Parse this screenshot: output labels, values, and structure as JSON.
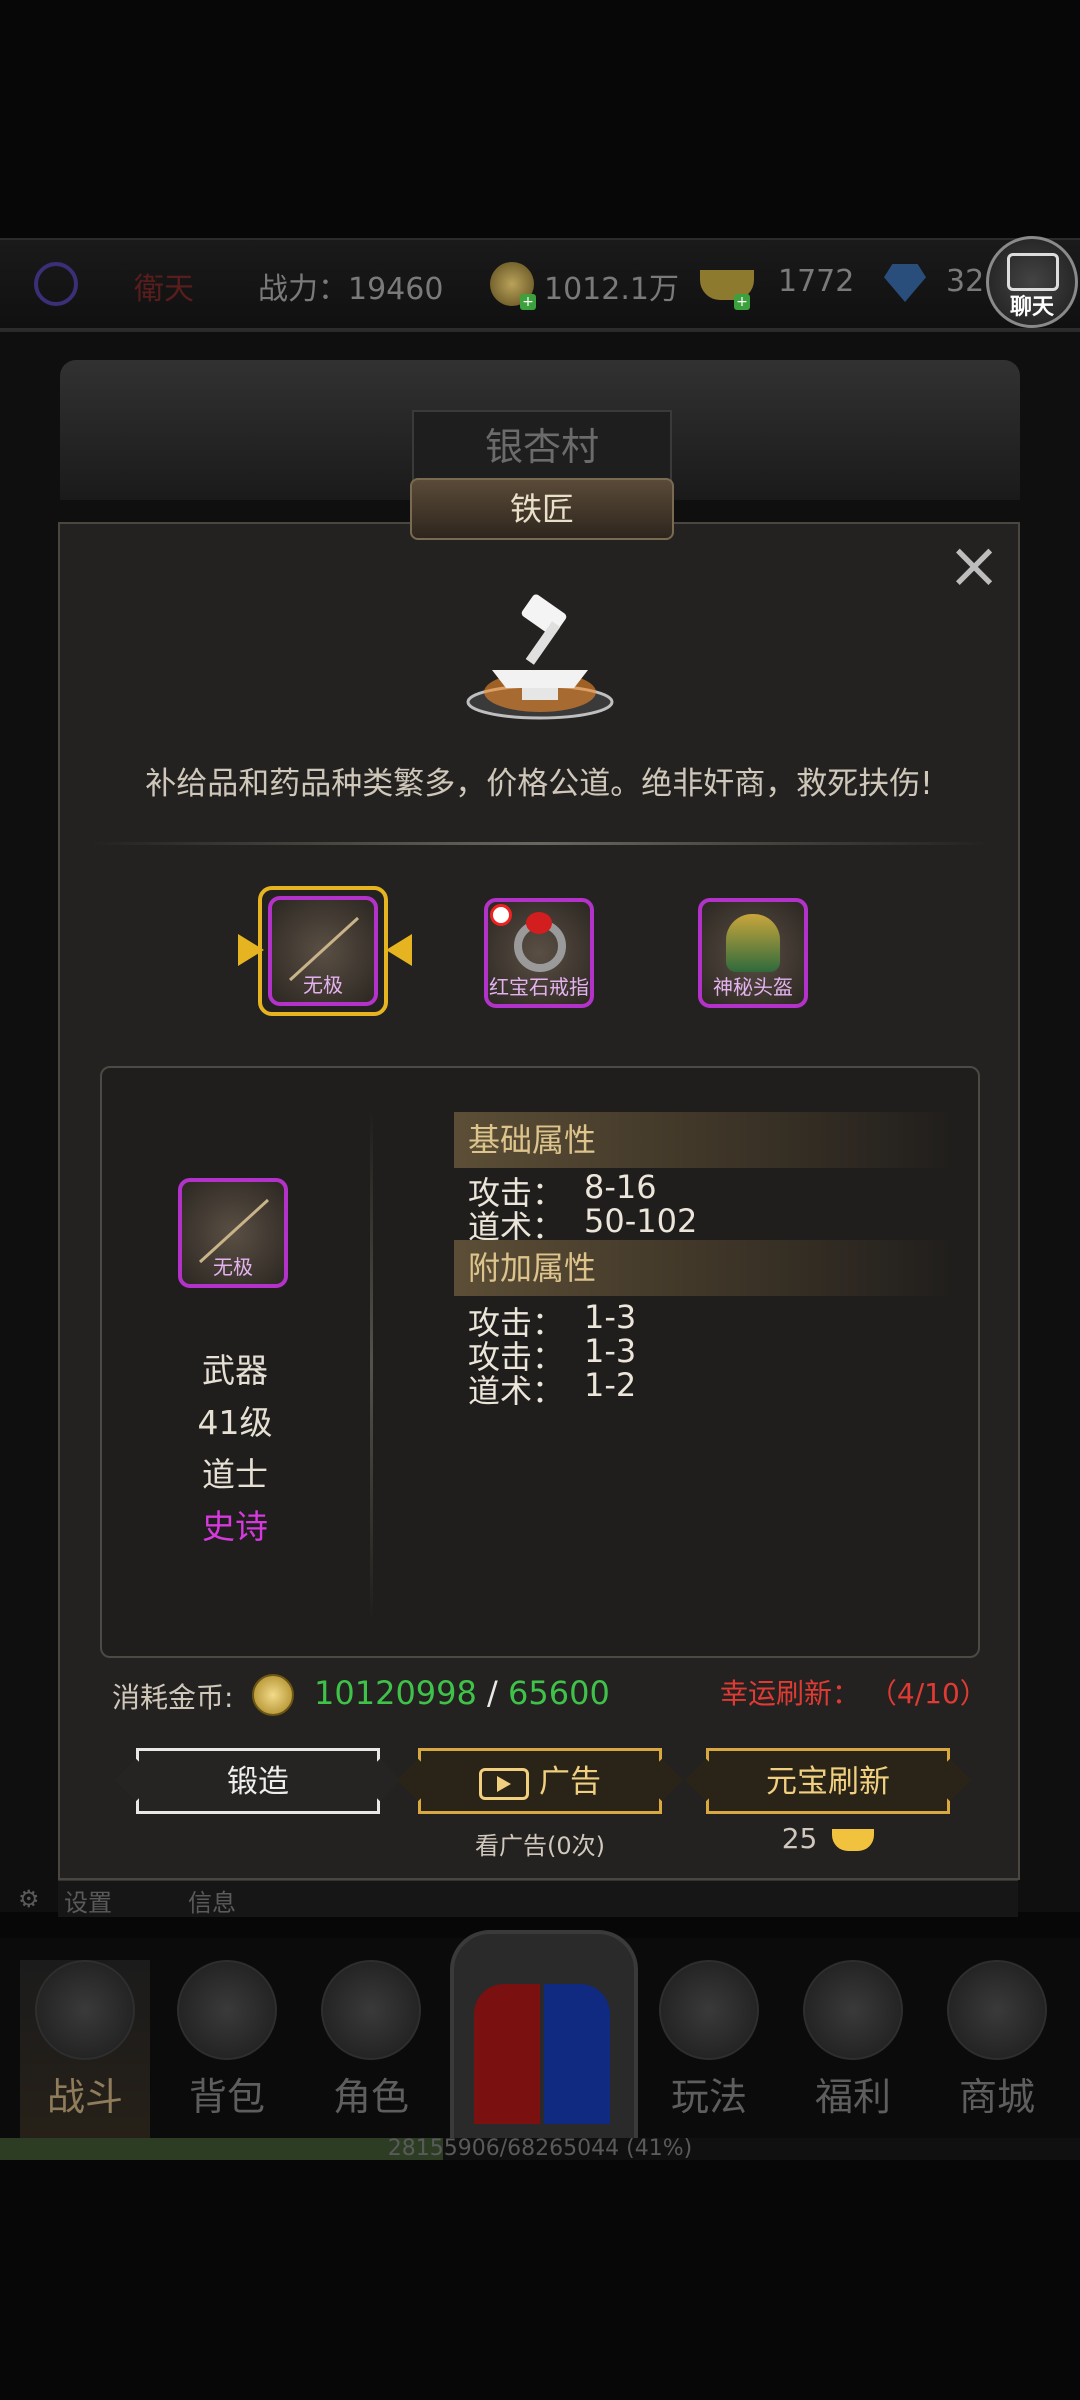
{
  "hud": {
    "name": "衛天",
    "power": "战力：19460",
    "coins": "1012.1万",
    "ingots": "1772",
    "diamonds": "32",
    "chat_label": "聊天"
  },
  "scene": {
    "village": "银杏村",
    "npc": "铁匠"
  },
  "panel": {
    "close": "×",
    "slogan": "补给品和药品种类繁多，价格公道。绝非奸商，救死扶伤!",
    "items": [
      {
        "label": "无极"
      },
      {
        "label": "红宝石戒指"
      },
      {
        "label": "神秘头盔"
      }
    ],
    "detail": {
      "item_label": "无极",
      "type": "武器",
      "level": "41级",
      "class": "道士",
      "quality": "史诗",
      "quality_color": "#d63adf",
      "base_title": "基础属性",
      "base_stats": [
        {
          "name": "攻击：",
          "value": "8-16"
        },
        {
          "name": "道术：",
          "value": "50-102"
        }
      ],
      "extra_title": "附加属性",
      "extra_stats": [
        {
          "name": "攻击：",
          "value": "1-3"
        },
        {
          "name": "攻击：",
          "value": "1-3"
        },
        {
          "name": "道术：",
          "value": "1-2"
        }
      ]
    },
    "cost": {
      "label": "消耗金币:",
      "have": "10120998",
      "sep": " / ",
      "need": "65600",
      "have_color": "#3fc24a",
      "need_color": "#3fc24a"
    },
    "lucky": "幸运刷新： （4/10）",
    "buttons": {
      "forge": "锻造",
      "ad": "广告",
      "ad_sub": "看广告(0次)",
      "refresh": "元宝刷新",
      "refresh_cost": "25"
    }
  },
  "under_panel": {
    "settings": "设置",
    "info": "信息"
  },
  "nav": [
    {
      "label": "战斗",
      "icon": "swords-icon"
    },
    {
      "label": "背包",
      "icon": "backpack-icon"
    },
    {
      "label": "角色",
      "icon": "character-icon"
    },
    {
      "label": "玩法",
      "icon": "gameplay-icon"
    },
    {
      "label": "福利",
      "icon": "chest-icon"
    },
    {
      "label": "商城",
      "icon": "shop-icon"
    }
  ],
  "xp": {
    "text": "28155906/68265044 (41%)",
    "fraction": 0.41
  }
}
